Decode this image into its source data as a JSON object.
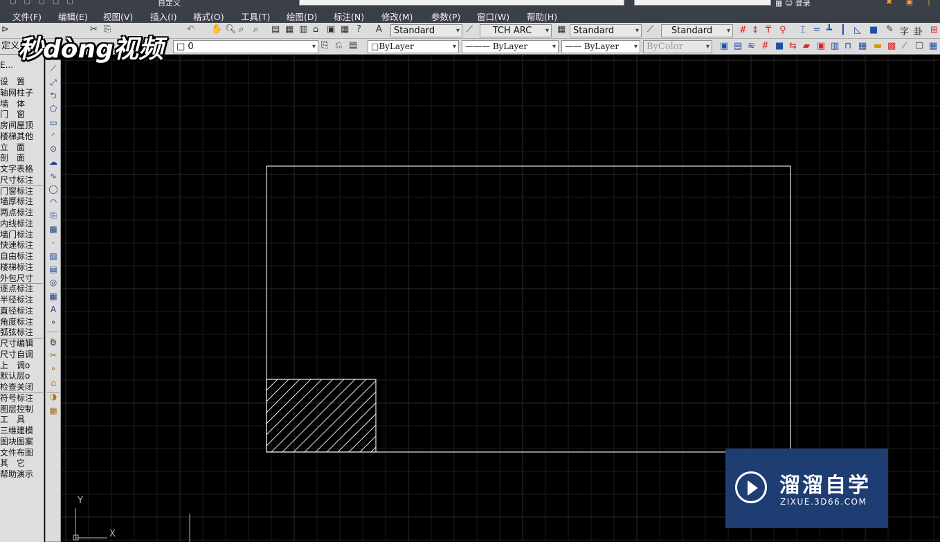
{
  "window": {
    "document_name": "自定义",
    "user_name": "登录"
  },
  "menu": {
    "items": [
      "文件(F)",
      "编辑(E)",
      "视图(V)",
      "插入(I)",
      "格式(O)",
      "工具(T)",
      "绘图(D)",
      "标注(N)",
      "修改(M)",
      "参数(P)",
      "窗口(W)",
      "帮助(H)"
    ]
  },
  "toolbar1": {
    "text_style": "Standard",
    "dim_style": "TCH ARC",
    "table_style": "Standard",
    "multileader_style": "Standard"
  },
  "toolbar2": {
    "workspace": "定义",
    "layer": "0",
    "color": "ByLayer",
    "linetype": "ByLayer",
    "lineweight": "ByLayer",
    "plot_style": "ByColor"
  },
  "left_panel": {
    "title": "E...",
    "items": [
      "设　置",
      "轴网柱子",
      "墙　体",
      "门　窗",
      "房间屋顶",
      "楼梯其他",
      "立　面",
      "剖　面",
      "文字表格",
      "尺寸标注",
      "门窗标注",
      "墙厚标注",
      "两点标注",
      "内线标注",
      "墙门标注",
      "快速标注",
      "自由标注",
      "楼梯标注",
      "外包尺寸",
      "逐点标注",
      "半径标注",
      "直径标注",
      "角度标注",
      "弧弦标注",
      "尺寸编辑",
      "尺寸自调",
      "上　调o",
      "默认层o",
      "检查关闭",
      "符号标注",
      "图层控制",
      "工　具",
      "三维建模",
      "图块图案",
      "文件布图",
      "其　它",
      "帮助演示"
    ]
  },
  "draw_tools": [
    "line",
    "construction-line",
    "polyline",
    "polygon",
    "rectangle",
    "arc",
    "circle",
    "revision-cloud",
    "spline",
    "ellipse",
    "ellipse-arc",
    "insert-block",
    "make-block",
    "point",
    "hatch",
    "gradient",
    "region",
    "table",
    "multiline-text",
    "add-selected",
    "modify-tools"
  ],
  "drawing": {
    "outer_rect": "rectangle",
    "hatched_rect": "ANSI31 hatch",
    "ucs_x": "X",
    "ucs_y": "Y"
  },
  "watermarks": {
    "top_left": "秒dòng视频",
    "bottom_right_brand": "溜溜自学",
    "bottom_right_site": "ZIXUE.3D66.COM"
  },
  "colors": {
    "canvas": "#000000",
    "grid_minor": "#1c1c1c",
    "grid_major": "#2c2c2c",
    "geometry": "#e6e6e6",
    "toolbar_bg": "#dcdcdc",
    "menubar_bg": "#3b3f48",
    "zixue_bg": "#1e3d73"
  }
}
